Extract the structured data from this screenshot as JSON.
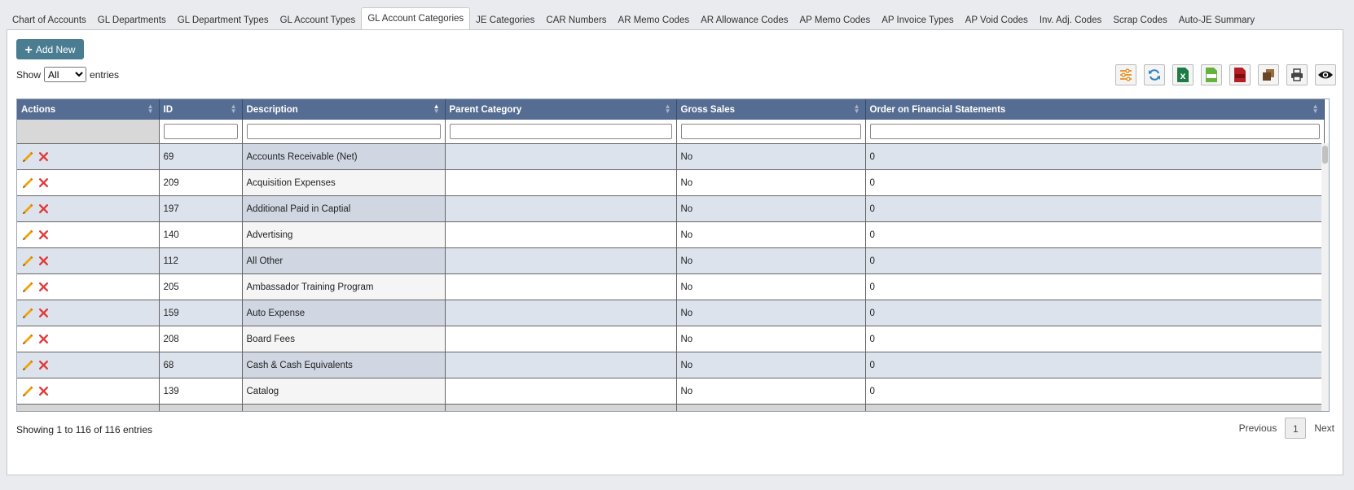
{
  "tabs": [
    {
      "label": "Chart of Accounts",
      "active": false
    },
    {
      "label": "GL Departments",
      "active": false
    },
    {
      "label": "GL Department Types",
      "active": false
    },
    {
      "label": "GL Account Types",
      "active": false
    },
    {
      "label": "GL Account Categories",
      "active": true
    },
    {
      "label": "JE Categories",
      "active": false
    },
    {
      "label": "CAR Numbers",
      "active": false
    },
    {
      "label": "AR Memo Codes",
      "active": false
    },
    {
      "label": "AR Allowance Codes",
      "active": false
    },
    {
      "label": "AP Memo Codes",
      "active": false
    },
    {
      "label": "AP Invoice Types",
      "active": false
    },
    {
      "label": "AP Void Codes",
      "active": false
    },
    {
      "label": "Inv. Adj. Codes",
      "active": false
    },
    {
      "label": "Scrap Codes",
      "active": false
    },
    {
      "label": "Auto-JE Summary",
      "active": false
    }
  ],
  "add_button": {
    "icon": "plus-icon",
    "label": "Add New"
  },
  "show": {
    "prefix": "Show",
    "selected": "All",
    "suffix": "entries"
  },
  "toolbar_icons": [
    "column-settings-icon",
    "refresh-icon",
    "excel-export-icon",
    "csv-export-icon",
    "pdf-export-icon",
    "copy-icon",
    "print-icon",
    "visibility-icon"
  ],
  "table": {
    "columns": [
      "Actions",
      "ID",
      "Description",
      "Parent Category",
      "Gross Sales",
      "Order on Financial Statements"
    ],
    "rows": [
      {
        "id": "69",
        "description": "Accounts Receivable (Net)",
        "parent": "",
        "gross_sales": "No",
        "order": "0"
      },
      {
        "id": "209",
        "description": "Acquisition Expenses",
        "parent": "",
        "gross_sales": "No",
        "order": "0"
      },
      {
        "id": "197",
        "description": "Additional Paid in Captial",
        "parent": "",
        "gross_sales": "No",
        "order": "0"
      },
      {
        "id": "140",
        "description": "Advertising",
        "parent": "",
        "gross_sales": "No",
        "order": "0"
      },
      {
        "id": "112",
        "description": "All Other",
        "parent": "",
        "gross_sales": "No",
        "order": "0"
      },
      {
        "id": "205",
        "description": "Ambassador Training Program",
        "parent": "",
        "gross_sales": "No",
        "order": "0"
      },
      {
        "id": "159",
        "description": "Auto Expense",
        "parent": "",
        "gross_sales": "No",
        "order": "0"
      },
      {
        "id": "208",
        "description": "Board Fees",
        "parent": "",
        "gross_sales": "No",
        "order": "0"
      },
      {
        "id": "68",
        "description": "Cash & Cash Equivalents",
        "parent": "",
        "gross_sales": "No",
        "order": "0"
      },
      {
        "id": "139",
        "description": "Catalog",
        "parent": "",
        "gross_sales": "No",
        "order": "0"
      }
    ]
  },
  "footer": {
    "info": "Showing 1 to 116 of 116 entries",
    "previous": "Previous",
    "page": "1",
    "next": "Next"
  },
  "colors": {
    "header": "#566d93",
    "accent": "#4a7d92",
    "edit": "#f0a30a",
    "delete": "#e03a3a"
  }
}
